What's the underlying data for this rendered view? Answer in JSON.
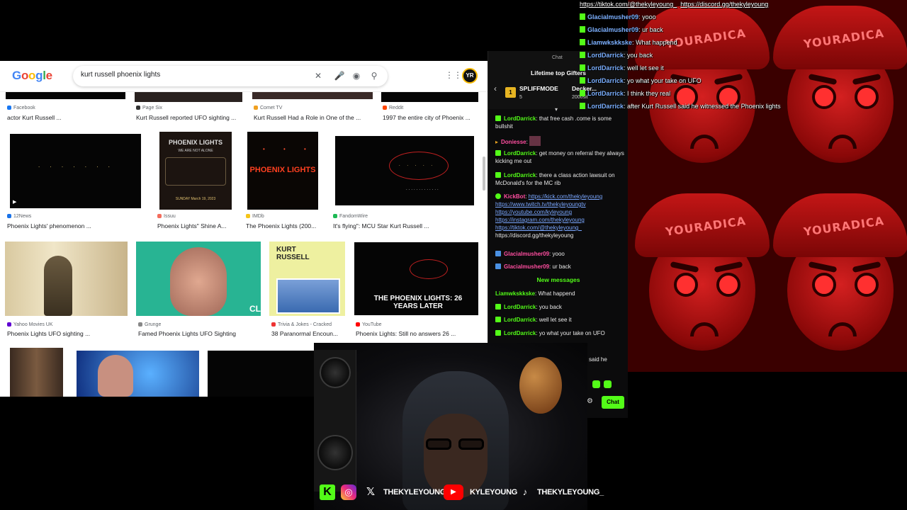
{
  "overlay_chat": {
    "links": [
      "https://tiktok.com/@thekyleyoung_",
      "https://discord.gg/thekyleyoung"
    ],
    "messages": [
      {
        "user": "Glacialmusher09",
        "text": "yooo"
      },
      {
        "user": "Glacialmusher09",
        "text": "ur back"
      },
      {
        "user": "Liamwkskkske",
        "text": "What happend"
      },
      {
        "user": "LordDarrick",
        "text": "you back"
      },
      {
        "user": "LordDarrick",
        "text": "well let see it"
      },
      {
        "user": "LordDarrick",
        "text": "yo what your take on UFO"
      },
      {
        "user": "LordDarrick",
        "text": "I think they real"
      },
      {
        "user": "LordDarrick",
        "text": "after Kurt Russell said he witnessed the Phoenix lights"
      }
    ]
  },
  "wallpaper": {
    "cap_text": "YOURADICA"
  },
  "google": {
    "logo": "Google",
    "query": "kurt russell phoenix lights",
    "avatar": "YR",
    "row0": [
      {
        "source": "Facebook",
        "caption": "actor Kurt Russell ...",
        "color": "#1877f2"
      },
      {
        "source": "Page Six",
        "caption": "Kurt Russell reported UFO sighting ...",
        "color": "#333333"
      },
      {
        "source": "Comet TV",
        "caption": "Kurt Russell Had a Role in One of the ...",
        "color": "#f0a020"
      },
      {
        "source": "Reddit",
        "caption": "1997 the entire city of Phoenix ...",
        "color": "#ff4500"
      }
    ],
    "row1": [
      {
        "source": "12News",
        "caption": "Phoenix Lights' phenomenon ...",
        "color": "#1a73e8"
      },
      {
        "source": "Issuu",
        "caption": "Phoenix Lights\" Shine A...",
        "color": "#f36d5d"
      },
      {
        "source": "IMDb",
        "caption": "The Phoenix Lights (200...",
        "color": "#f5c518"
      },
      {
        "source": "FandomWire",
        "caption": "It's flying\": MCU Star Kurt Russell ...",
        "color": "#1db954"
      }
    ],
    "row2": [
      {
        "source": "Yahoo Movies UK",
        "caption": "Phoenix Lights UFO sighting ...",
        "color": "#6001d2"
      },
      {
        "source": "Grunge",
        "caption": "Famed Phoenix Lights UFO Sighting",
        "color": "#888888"
      },
      {
        "source": "Trivia & Jokes - Cracked",
        "caption": "38 Paranormal Encoun...",
        "color": "#e33"
      },
      {
        "source": "YouTube",
        "caption": "Phoenix Lights: Still no answers 26 ...",
        "color": "#ff0000"
      }
    ],
    "poster": {
      "title": "PHOENIX LIGHTS",
      "tagline": "WE ARE NOT ALONE",
      "date": "SUNDAY March 19, 2023"
    },
    "imdb_title": "PHOENIX LIGHTS",
    "magazine": {
      "title": "KURT RUSSELL"
    },
    "yt_title": "THE PHOENIX LIGHTS: 26 YEARS LATER",
    "grunge_tag": "CL"
  },
  "chat": {
    "tab": "Chat",
    "gifters_title": "Lifetime top Gifters",
    "gifters": [
      {
        "rank": "1",
        "name": "SPLIFFMODE",
        "count": "5"
      },
      {
        "rank": "",
        "name": "Decker...",
        "count": "2000sit"
      }
    ],
    "messages": [
      {
        "user": "LordDarrick",
        "text": "that free cash .come is some bullshit",
        "style": "k"
      },
      {
        "user": "Doniesse",
        "text": "",
        "style": "pk"
      },
      {
        "user": "LordDarrick",
        "text": "get money on referral they always kicking me out",
        "style": "k"
      },
      {
        "user": "LordDarrick",
        "text": "there a class action lawsuit on McDonald's for the MC rib",
        "style": "k"
      }
    ],
    "kickbot": {
      "user": "KickBot",
      "links": [
        "https://kick.com/thekyleyoung",
        "https://www.twitch.tv/thekyleyoungtv",
        "https://youtube.com/kyleyoung",
        "https://instagram.com/thekyleyoung",
        "https://tiktok.com/@thekyleyoung_"
      ],
      "tail": "https://discord.gg/thekyleyoung"
    },
    "messages2": [
      {
        "user": "Glacialmusher09",
        "text": "yooo"
      },
      {
        "user": "Glacialmusher09",
        "text": "ur back"
      }
    ],
    "new_messages": "New messages",
    "messages3": [
      {
        "user": "Liamwkskkske",
        "text": "What happend"
      },
      {
        "user": "LordDarrick",
        "text": "you back"
      },
      {
        "user": "LordDarrick",
        "text": "well let see it"
      },
      {
        "user": "LordDarrick",
        "text": "yo what your take on UFO"
      }
    ],
    "partial": "said he",
    "send_label": "Chat"
  },
  "social": [
    {
      "icon": "instagram-icon",
      "label": ""
    },
    {
      "icon": "x-icon",
      "label": "THEKYLEYOUNG"
    },
    {
      "icon": "youtube-icon",
      "label": "KYLEYOUNG"
    },
    {
      "icon": "tiktok-icon",
      "label": "THEKYLEYOUNG_"
    }
  ]
}
